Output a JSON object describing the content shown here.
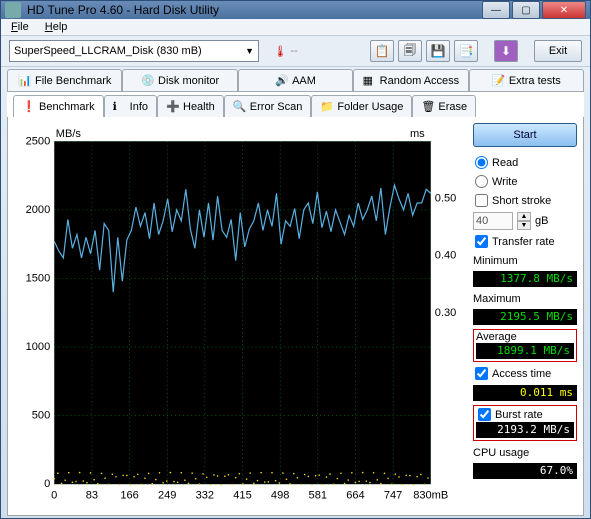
{
  "window": {
    "title": "HD Tune Pro 4.60 - Hard Disk Utility"
  },
  "menu": {
    "file": "File",
    "help": "Help"
  },
  "toolbar": {
    "drive": "SuperSpeed_LLCRAM_Disk (830 mB)",
    "temp": "--",
    "exit": "Exit"
  },
  "tabs_row1": [
    {
      "label": "File Benchmark"
    },
    {
      "label": "Disk monitor"
    },
    {
      "label": "AAM"
    },
    {
      "label": "Random Access"
    },
    {
      "label": "Extra tests"
    }
  ],
  "tabs_row2": [
    {
      "label": "Benchmark"
    },
    {
      "label": "Info"
    },
    {
      "label": "Health"
    },
    {
      "label": "Error Scan"
    },
    {
      "label": "Folder Usage"
    },
    {
      "label": "Erase"
    }
  ],
  "side": {
    "start": "Start",
    "read": "Read",
    "write": "Write",
    "short_stroke": "Short stroke",
    "stroke_val": "40",
    "stroke_unit": "gB",
    "transfer_rate": "Transfer rate",
    "minimum": "Minimum",
    "minimum_val": "1377.8 MB/s",
    "maximum": "Maximum",
    "maximum_val": "2195.5 MB/s",
    "average": "Average",
    "average_val": "1899.1 MB/s",
    "access_time": "Access time",
    "access_val": "0.011 ms",
    "burst_rate": "Burst rate",
    "burst_val": "2193.2 MB/s",
    "cpu_usage": "CPU usage",
    "cpu_val": "67.0%"
  },
  "chart_data": {
    "type": "line",
    "y_left_label": "MB/s",
    "y_right_label": "ms",
    "y_left_ticks": [
      0,
      500,
      1000,
      1500,
      2000,
      2500
    ],
    "y_right_ticks": [
      0.3,
      0.4,
      0.5
    ],
    "x_ticks": [
      0,
      83,
      166,
      249,
      332,
      415,
      498,
      581,
      664,
      747,
      "830mB"
    ],
    "x_range": [
      0,
      830
    ],
    "y_left_range": [
      0,
      2500
    ],
    "series": [
      {
        "name": "Transfer rate",
        "color": "#5ab0e0",
        "axis": "left",
        "x": [
          0,
          10,
          20,
          30,
          40,
          50,
          60,
          70,
          80,
          90,
          100,
          110,
          120,
          130,
          140,
          150,
          160,
          170,
          180,
          190,
          200,
          210,
          220,
          230,
          240,
          250,
          260,
          270,
          280,
          290,
          300,
          310,
          320,
          330,
          340,
          350,
          360,
          370,
          380,
          390,
          400,
          410,
          420,
          430,
          440,
          450,
          460,
          470,
          480,
          490,
          500,
          510,
          520,
          530,
          540,
          550,
          560,
          570,
          580,
          590,
          600,
          610,
          620,
          630,
          640,
          650,
          660,
          670,
          680,
          690,
          700,
          710,
          720,
          730,
          740,
          750,
          760,
          770,
          780,
          790,
          800,
          810,
          820,
          830
        ],
        "y": [
          1770,
          1700,
          1650,
          1930,
          1720,
          1820,
          1650,
          1800,
          1680,
          1850,
          1560,
          1900,
          1850,
          1400,
          1800,
          1480,
          1780,
          1850,
          2020,
          1880,
          1980,
          1790,
          2050,
          1820,
          1920,
          2080,
          1840,
          2000,
          1920,
          2150,
          1860,
          1720,
          2000,
          1800,
          2050,
          1780,
          2100,
          1850,
          1800,
          1930,
          1630,
          1980,
          1730,
          1860,
          1920,
          2050,
          1850,
          2000,
          1880,
          2120,
          1750,
          1920,
          1880,
          2010,
          1790,
          2000,
          2050,
          1900,
          2130,
          1870,
          1990,
          1840,
          2000,
          1910,
          1820,
          1960,
          1880,
          2050,
          1930,
          2000,
          2100,
          1920,
          2160,
          1820,
          2020,
          2180,
          2080,
          2000,
          2120,
          1960,
          2050,
          2050,
          2150,
          2120
        ]
      },
      {
        "name": "Access time",
        "color": "#f0d020",
        "axis": "right",
        "approx_y_left_equiv": 40,
        "approx_ms": 0.011
      }
    ]
  }
}
